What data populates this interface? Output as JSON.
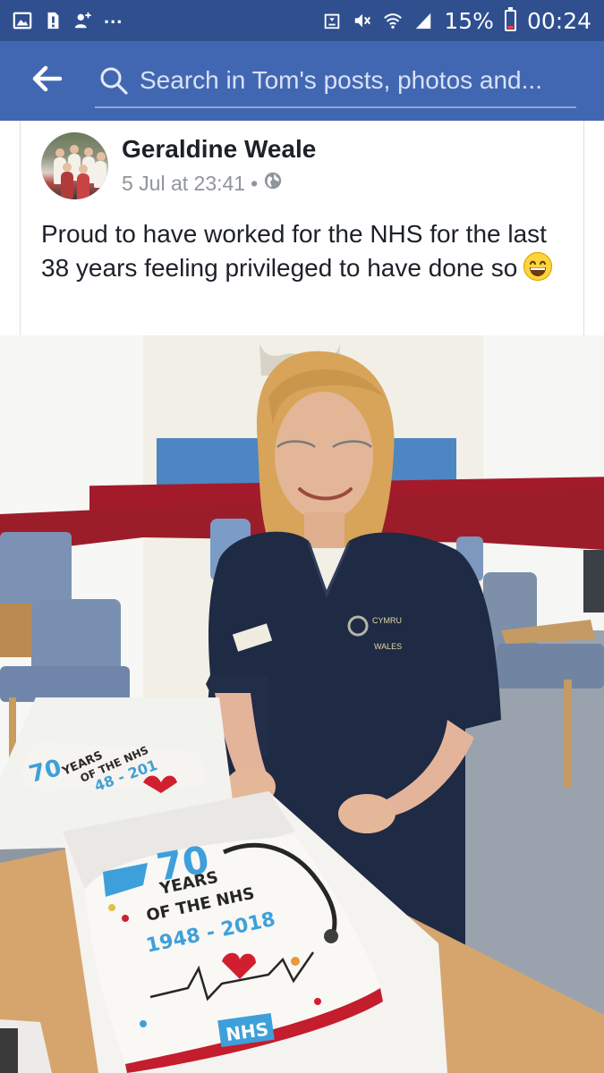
{
  "status_bar": {
    "battery": "15%",
    "time": "00:24",
    "overflow": "...",
    "icons": [
      "gallery-icon",
      "sim-alert-icon",
      "add-contact-icon",
      "recycle-icon",
      "mute-icon",
      "wifi-icon",
      "signal-icon",
      "battery-icon"
    ]
  },
  "header": {
    "back_icon": "arrow-left-icon",
    "search_placeholder": "Search in Tom's posts, photos and...",
    "search_icon": "search-icon"
  },
  "post": {
    "author": "Geraldine Weale",
    "date": "5 Jul at 23:41",
    "separator": "•",
    "privacy_icon": "globe-icon",
    "text": "Proud to have worked for the NHS for the last 38 years feeling privileged to have done so",
    "emoji": "grinning-face-icon"
  },
  "photo": {
    "badge_line1": "CYMRU",
    "badge_line2": "WALES",
    "front_cake": {
      "number": "70",
      "line1": "YEARS",
      "line2": "OF THE NHS",
      "years": "1948 - 2018",
      "logo": "NHS"
    },
    "back_cake": {
      "number": "70",
      "line1": "YEARS",
      "line2": "OF THE NHS",
      "years": "48 - 201"
    }
  },
  "colors": {
    "status_bar": "#2f4f8f",
    "header": "#4267b2",
    "text": "#1d2129",
    "meta": "#90949c"
  }
}
